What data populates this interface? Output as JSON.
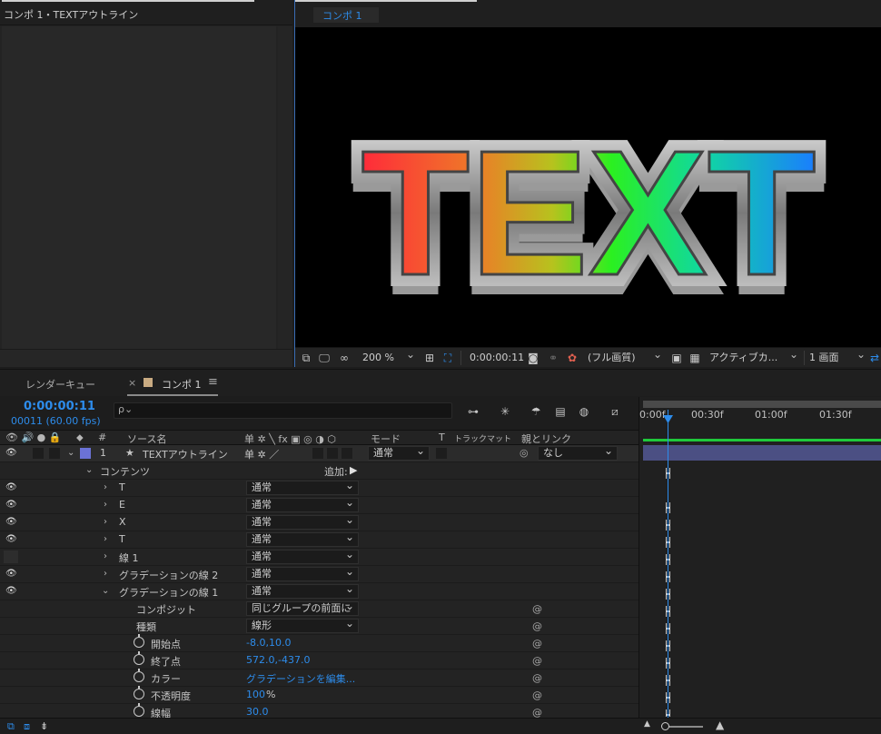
{
  "project_panel": {
    "title": "コンポ 1・TEXTアウトライン"
  },
  "viewer": {
    "tab": "コンポ 1",
    "canvas_text": "TEXT",
    "toolbar": {
      "zoom": "200 %",
      "timecode": "0:00:00:11",
      "resolution": "(フル画質)",
      "camera": "アクティブカ...",
      "views": "1 画面"
    }
  },
  "timeline": {
    "tabs": {
      "render_queue": "レンダーキュー",
      "close": "×",
      "comp": "コンポ 1",
      "menu": "≡"
    },
    "current_time": "0:00:00:11",
    "frames": "00011 (60.00 fps)",
    "search_placeholder": "ρ⌄",
    "columns": {
      "hash": "#",
      "source_name": "ソース名",
      "switches": "单 ✲ ╲ fx ▣ ◎ ◑ ⬡",
      "mode": "モード",
      "t": "T",
      "track_matte": "トラックマット",
      "parent": "親とリンク"
    },
    "layer": {
      "number": "1",
      "star": "★",
      "name": "TEXTアウトライン",
      "switches": "单 ✲ ／",
      "mode": "通常",
      "parent": "なし",
      "parent_icon": "◎"
    },
    "contents": {
      "label": "コンテンツ",
      "add_label": "追加:",
      "add_icon": "▶"
    },
    "rows": [
      {
        "name": "T",
        "mode": "通常"
      },
      {
        "name": "E",
        "mode": "通常"
      },
      {
        "name": "X",
        "mode": "通常"
      },
      {
        "name": "T",
        "mode": "通常"
      },
      {
        "name": "線 1",
        "mode": "通常"
      },
      {
        "name": "グラデーションの線 2",
        "mode": "通常"
      },
      {
        "name": "グラデーションの線 1",
        "mode": "通常"
      }
    ],
    "props": [
      {
        "name": "コンポジット",
        "value": "同じグループの前面に"
      },
      {
        "name": "種類",
        "value": "線形"
      },
      {
        "name": "開始点",
        "value": "-8.0,10.0"
      },
      {
        "name": "終了点",
        "value": "572.0,-437.0"
      },
      {
        "name": "カラー",
        "value": "グラデーションを編集..."
      },
      {
        "name": "不透明度",
        "value": "100",
        "unit": "%"
      },
      {
        "name": "線幅",
        "value": "30.0"
      }
    ],
    "ruler": [
      "0:00f",
      "00:30f",
      "01:00f",
      "01:30f"
    ]
  },
  "colors": {
    "accent_blue": "#2d8ceb",
    "layer_label": "#6b72d6",
    "layer_bar": "#4b4f83",
    "green_bar": "#1fc93b"
  }
}
